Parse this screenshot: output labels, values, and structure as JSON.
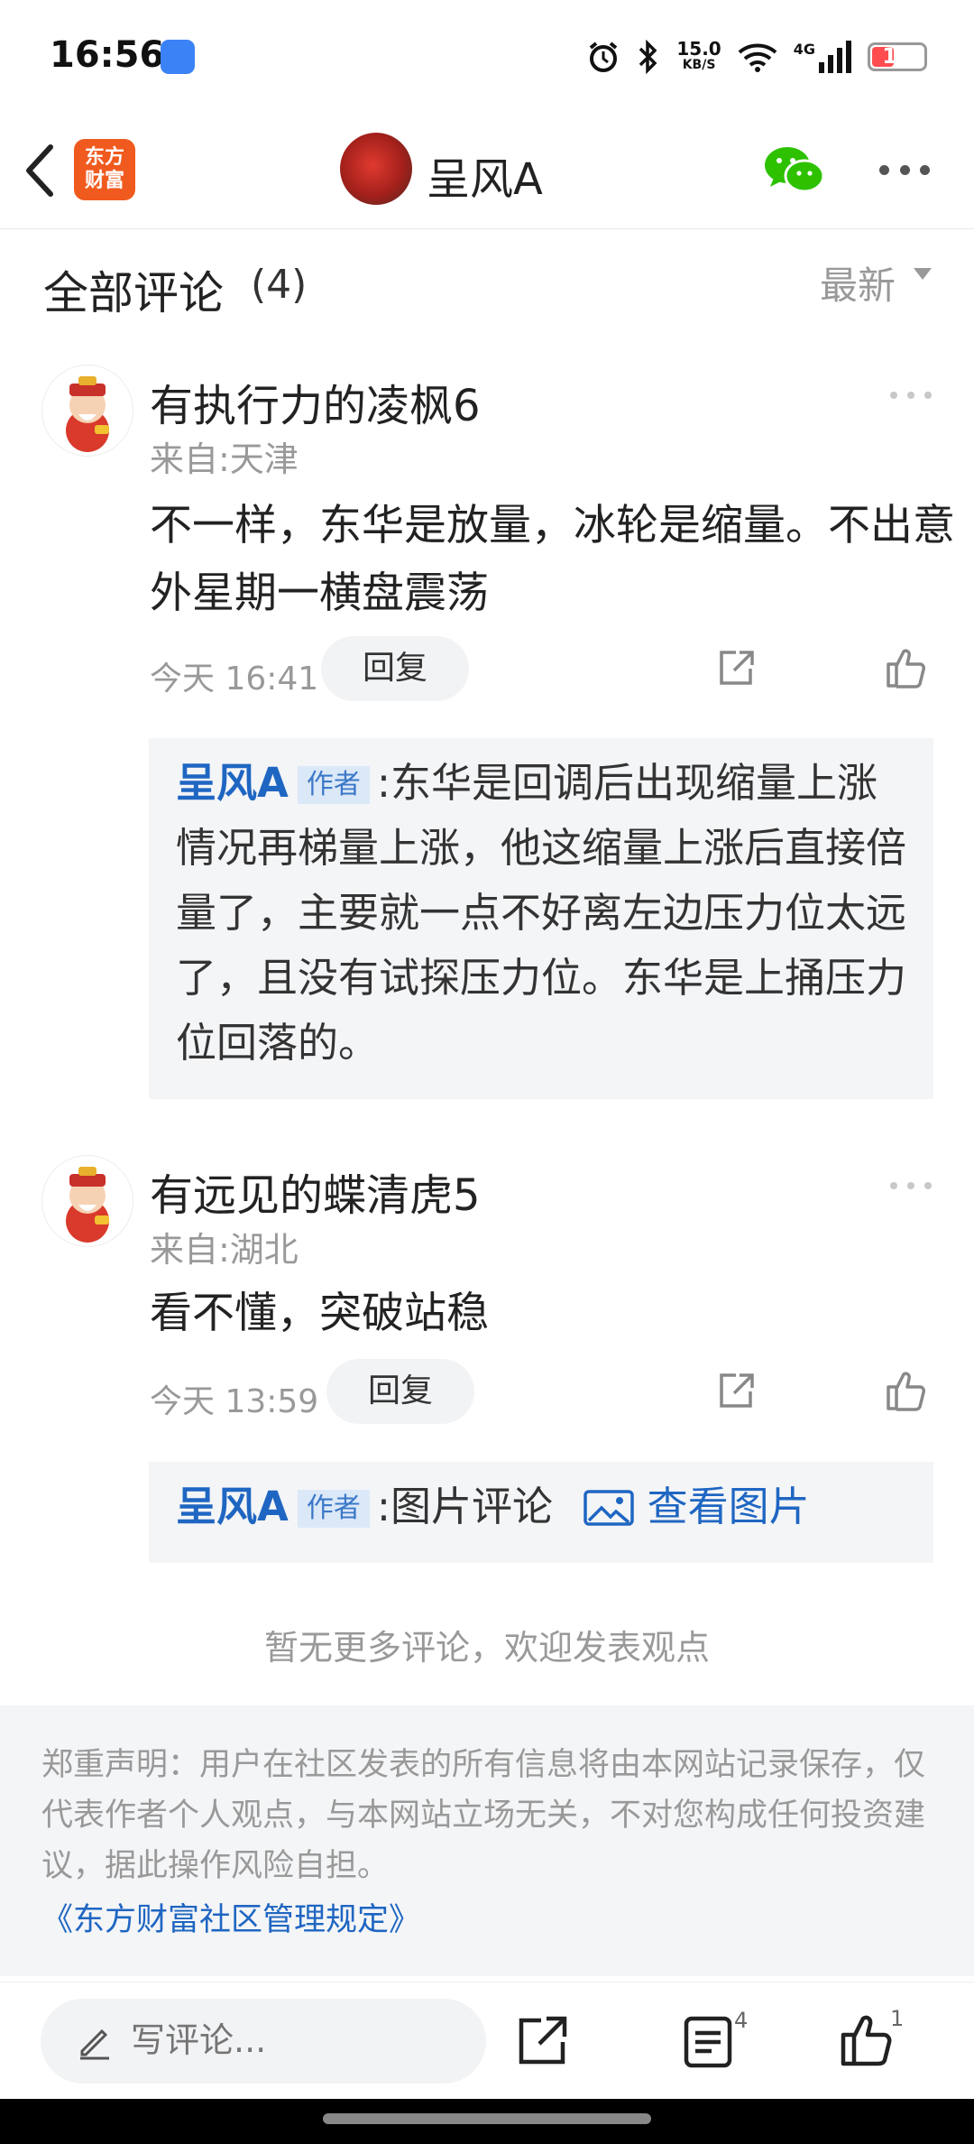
{
  "status_bar": {
    "time": "16:56",
    "net_speed": "15.0",
    "net_unit": "KB/S",
    "battery": "19",
    "network": "4G"
  },
  "header": {
    "logo_line1": "东方",
    "logo_line2": "财富",
    "title": "呈风A"
  },
  "comments_header": {
    "title": "全部评论",
    "count": "(4)",
    "sort": "最新"
  },
  "comments": [
    {
      "user": "有执行力的凌枫6",
      "location": "来自:天津",
      "text": "不一样，东华是放量，冰轮是缩量。不出意外星期一横盘震荡",
      "time": "今天 16:41",
      "reply_label": "回复",
      "reply": {
        "author": "呈风A",
        "tag": "作者",
        "text": ":东华是回调后出现缩量上涨情况再梯量上涨，他这缩量上涨后直接倍量了，主要就一点不好离左边压力位太远了，且没有试探压力位。东华是上捅压力位回落的。"
      }
    },
    {
      "user": "有远见的蝶清虎5",
      "location": "来自:湖北",
      "text": "看不懂，突破站稳",
      "time": "今天 13:59",
      "reply_label": "回复",
      "reply": {
        "author": "呈风A",
        "tag": "作者",
        "text": ":图片评论",
        "view_image": "查看图片"
      }
    }
  ],
  "no_more": "暂无更多评论，欢迎发表观点",
  "disclaimer": {
    "text": "郑重声明：用户在社区发表的所有信息将由本网站记录保存，仅代表作者个人观点，与本网站立场无关，不对您构成任何投资建议，据此操作风险自担。",
    "link": "《东方财富社区管理规定》"
  },
  "bottom_bar": {
    "placeholder": "写评论...",
    "comment_count": "4",
    "like_count": "1"
  },
  "colors": {
    "accent_blue": "#1f66c2",
    "logo_orange": "#f05a1e",
    "wechat_green": "#2dc100"
  }
}
